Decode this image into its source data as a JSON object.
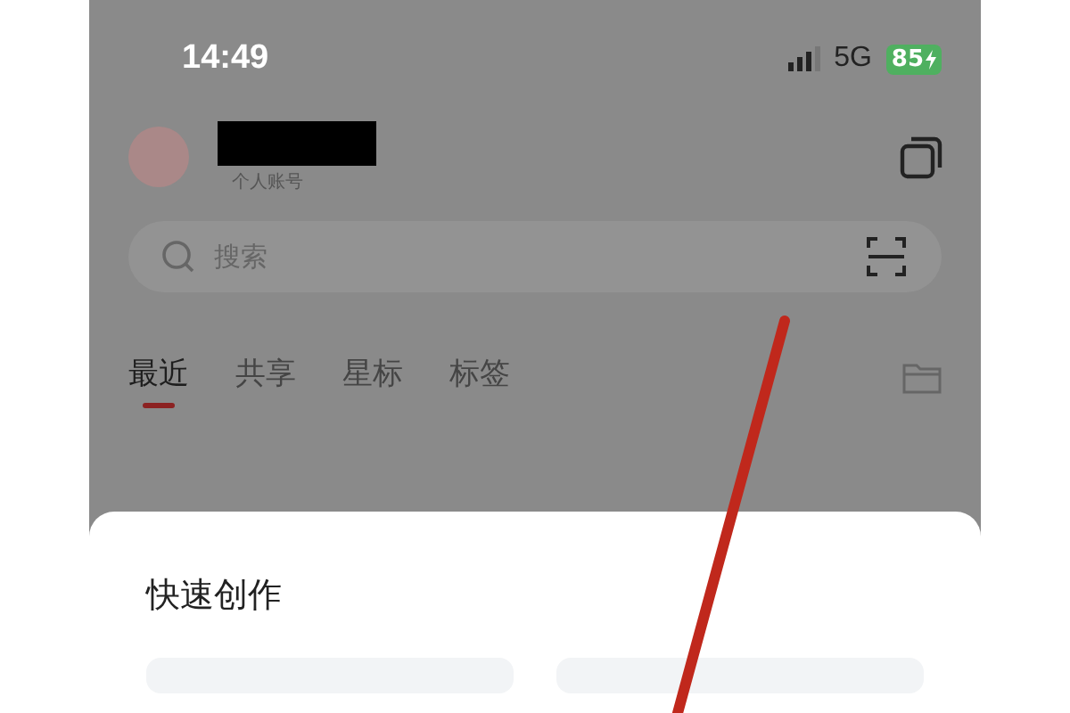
{
  "status_bar": {
    "time": "14:49",
    "network": "5G",
    "battery": "85"
  },
  "account": {
    "type": "个人账号"
  },
  "search": {
    "placeholder": "搜索"
  },
  "tabs": [
    {
      "label": "最近",
      "selected": true
    },
    {
      "label": "共享",
      "selected": false
    },
    {
      "label": "星标",
      "selected": false
    },
    {
      "label": "标签",
      "selected": false
    }
  ],
  "sheet": {
    "title": "快速创作"
  }
}
